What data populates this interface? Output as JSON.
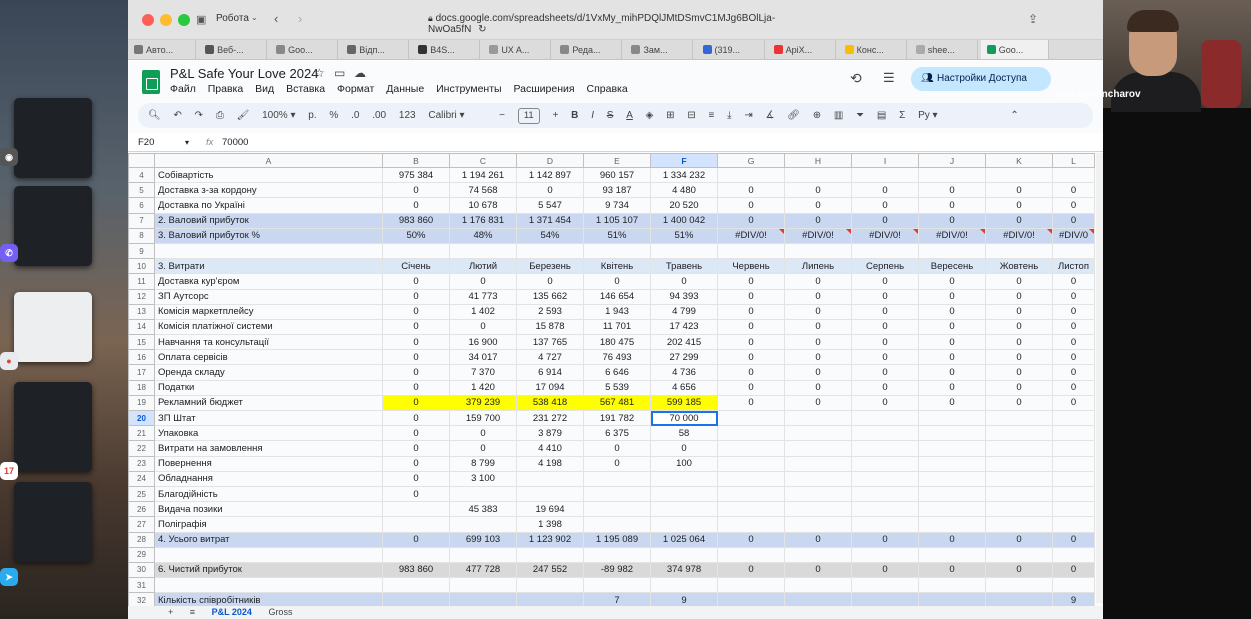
{
  "browser": {
    "profile": "Робота",
    "url": "docs.google.com/spreadsheets/d/1VxMy_mihPDQlJMtDSmvC1MJg6BOlLja-NwOa5fN",
    "tabs": [
      "Авто...",
      "Веб-...",
      "Goo...",
      "Відп...",
      "B4S...",
      "UX A...",
      "Реда...",
      "Зам...",
      "(319...",
      "ApiX...",
      "Конс...",
      "shee...",
      "Goo..."
    ]
  },
  "doc": {
    "title": "P&L Safe Your Love 2024",
    "menu": [
      "Файл",
      "Правка",
      "Вид",
      "Вставка",
      "Формат",
      "Данные",
      "Инструменты",
      "Расширения",
      "Справка"
    ],
    "share_label": "Настройки Доступа"
  },
  "toolbar": {
    "zoom": "100%",
    "currency": "р.",
    "percent": "%",
    "dec_less": ".0",
    "dec_more": ".00",
    "num_format": "123",
    "font": "Calibri",
    "font_size": "11"
  },
  "formula": {
    "cell_ref": "F20",
    "fx": "fx",
    "value": "70000"
  },
  "columns": [
    "A",
    "B",
    "C",
    "D",
    "E",
    "F",
    "G",
    "H",
    "I",
    "J",
    "K",
    "L"
  ],
  "rows": [
    {
      "n": "4",
      "style": "",
      "cells": [
        "Собівартість",
        "975 384",
        "1 194 261",
        "1 142 897",
        "960 157",
        "1 334 232",
        "",
        "",
        "",
        "",
        "",
        ""
      ]
    },
    {
      "n": "5",
      "style": "",
      "cells": [
        "Доставка з-за кордону",
        "0",
        "74 568",
        "0",
        "93 187",
        "4 480",
        "0",
        "0",
        "0",
        "0",
        "0",
        "0"
      ]
    },
    {
      "n": "6",
      "style": "",
      "cells": [
        "Доставка по Україні",
        "0",
        "10 678",
        "5 547",
        "9 734",
        "20 520",
        "0",
        "0",
        "0",
        "0",
        "0",
        "0"
      ]
    },
    {
      "n": "7",
      "style": "hl-blue",
      "cells": [
        "2. Валовий прибуток",
        "983 860",
        "1 176 831",
        "1 371 454",
        "1 105 107",
        "1 400 042",
        "0",
        "0",
        "0",
        "0",
        "0",
        "0"
      ]
    },
    {
      "n": "8",
      "style": "hl-blue",
      "cells": [
        "3. Валовий прибуток %",
        "50%",
        "48%",
        "54%",
        "51%",
        "51%",
        "#DIV/0!",
        "#DIV/0!",
        "#DIV/0!",
        "#DIV/0!",
        "#DIV/0!",
        "#DIV/0"
      ]
    },
    {
      "n": "9",
      "style": "",
      "cells": [
        "",
        "",
        "",
        "",
        "",
        "",
        "",
        "",
        "",
        "",
        "",
        ""
      ]
    },
    {
      "n": "10",
      "style": "hl-light",
      "cells": [
        "3. Витрати",
        "Січень",
        "Лютий",
        "Березень",
        "Квітень",
        "Травень",
        "Червень",
        "Липень",
        "Серпень",
        "Вересень",
        "Жовтень",
        "Листоп"
      ]
    },
    {
      "n": "11",
      "style": "",
      "cells": [
        "Доставка кур'єром",
        "0",
        "0",
        "0",
        "0",
        "0",
        "0",
        "0",
        "0",
        "0",
        "0",
        "0"
      ]
    },
    {
      "n": "12",
      "style": "",
      "cells": [
        "ЗП Аутсорс",
        "0",
        "41 773",
        "135 662",
        "146 654",
        "94 393",
        "0",
        "0",
        "0",
        "0",
        "0",
        "0"
      ]
    },
    {
      "n": "13",
      "style": "",
      "cells": [
        "Комісія маркетплейсу",
        "0",
        "1 402",
        "2 593",
        "1 943",
        "4 799",
        "0",
        "0",
        "0",
        "0",
        "0",
        "0"
      ]
    },
    {
      "n": "14",
      "style": "",
      "cells": [
        "Комісія платіжної системи",
        "0",
        "0",
        "15 878",
        "11 701",
        "17 423",
        "0",
        "0",
        "0",
        "0",
        "0",
        "0"
      ]
    },
    {
      "n": "15",
      "style": "",
      "cells": [
        "Навчання та консультації",
        "0",
        "16 900",
        "137 765",
        "180 475",
        "202 415",
        "0",
        "0",
        "0",
        "0",
        "0",
        "0"
      ]
    },
    {
      "n": "16",
      "style": "",
      "cells": [
        "Оплата сервісів",
        "0",
        "34 017",
        "4 727",
        "76 493",
        "27 299",
        "0",
        "0",
        "0",
        "0",
        "0",
        "0"
      ]
    },
    {
      "n": "17",
      "style": "",
      "cells": [
        "Оренда складу",
        "0",
        "7 370",
        "6 914",
        "6 646",
        "4 736",
        "0",
        "0",
        "0",
        "0",
        "0",
        "0"
      ]
    },
    {
      "n": "18",
      "style": "",
      "cells": [
        "Податки",
        "0",
        "1 420",
        "17 094",
        "5 539",
        "4 656",
        "0",
        "0",
        "0",
        "0",
        "0",
        "0"
      ]
    },
    {
      "n": "19",
      "style": "yellow",
      "cells": [
        "Рекламний бюджет",
        "0",
        "379 239",
        "538 418",
        "567 481",
        "599 185",
        "0",
        "0",
        "0",
        "0",
        "0",
        "0"
      ]
    },
    {
      "n": "20",
      "style": "active",
      "cells": [
        "ЗП Штат",
        "0",
        "159 700",
        "231 272",
        "191 782",
        "70 000",
        "",
        "",
        "",
        "",
        "",
        ""
      ]
    },
    {
      "n": "21",
      "style": "",
      "cells": [
        "Упаковка",
        "0",
        "0",
        "3 879",
        "6 375",
        "58",
        "",
        "",
        "",
        "",
        "",
        ""
      ]
    },
    {
      "n": "22",
      "style": "",
      "cells": [
        "Витрати на замовлення",
        "0",
        "0",
        "4 410",
        "0",
        "0",
        "",
        "",
        "",
        "",
        "",
        ""
      ]
    },
    {
      "n": "23",
      "style": "",
      "cells": [
        "Повернення",
        "0",
        "8 799",
        "4 198",
        "0",
        "100",
        "",
        "",
        "",
        "",
        "",
        ""
      ]
    },
    {
      "n": "24",
      "style": "",
      "cells": [
        "Обладнання",
        "0",
        "3 100",
        "",
        "",
        "",
        "",
        "",
        "",
        "",
        "",
        ""
      ]
    },
    {
      "n": "25",
      "style": "",
      "cells": [
        "Благодійність",
        "0",
        "",
        "",
        "",
        "",
        "",
        "",
        "",
        "",
        "",
        ""
      ]
    },
    {
      "n": "26",
      "style": "",
      "cells": [
        "Видача позики",
        "",
        "45 383",
        "19 694",
        "",
        "",
        "",
        "",
        "",
        "",
        "",
        ""
      ]
    },
    {
      "n": "27",
      "style": "",
      "cells": [
        "Поліграфія",
        "",
        "",
        "1 398",
        "",
        "",
        "",
        "",
        "",
        "",
        "",
        ""
      ]
    },
    {
      "n": "28",
      "style": "hl-blue",
      "cells": [
        "4. Усього витрат",
        "0",
        "699 103",
        "1 123 902",
        "1 195 089",
        "1 025 064",
        "0",
        "0",
        "0",
        "0",
        "0",
        "0"
      ]
    },
    {
      "n": "29",
      "style": "",
      "cells": [
        "",
        "",
        "",
        "",
        "",
        "",
        "",
        "",
        "",
        "",
        "",
        ""
      ]
    },
    {
      "n": "30",
      "style": "hl-grey",
      "cells": [
        "6. Чистий прибуток",
        "983 860",
        "477 728",
        "247 552",
        "-89 982",
        "374 978",
        "0",
        "0",
        "0",
        "0",
        "0",
        "0"
      ]
    },
    {
      "n": "31",
      "style": "",
      "cells": [
        "",
        "",
        "",
        "",
        "",
        "",
        "",
        "",
        "",
        "",
        "",
        ""
      ]
    },
    {
      "n": "32",
      "style": "hl-blue",
      "cells": [
        "Кількість співробітників",
        "",
        "",
        "",
        "7",
        "9",
        "",
        "",
        "",
        "",
        "",
        "9"
      ]
    }
  ],
  "sheet_tabs": [
    "+",
    "≡",
    "P&L 2024",
    "Gross"
  ],
  "webcam": {
    "name": "yevhenhoncharov"
  }
}
